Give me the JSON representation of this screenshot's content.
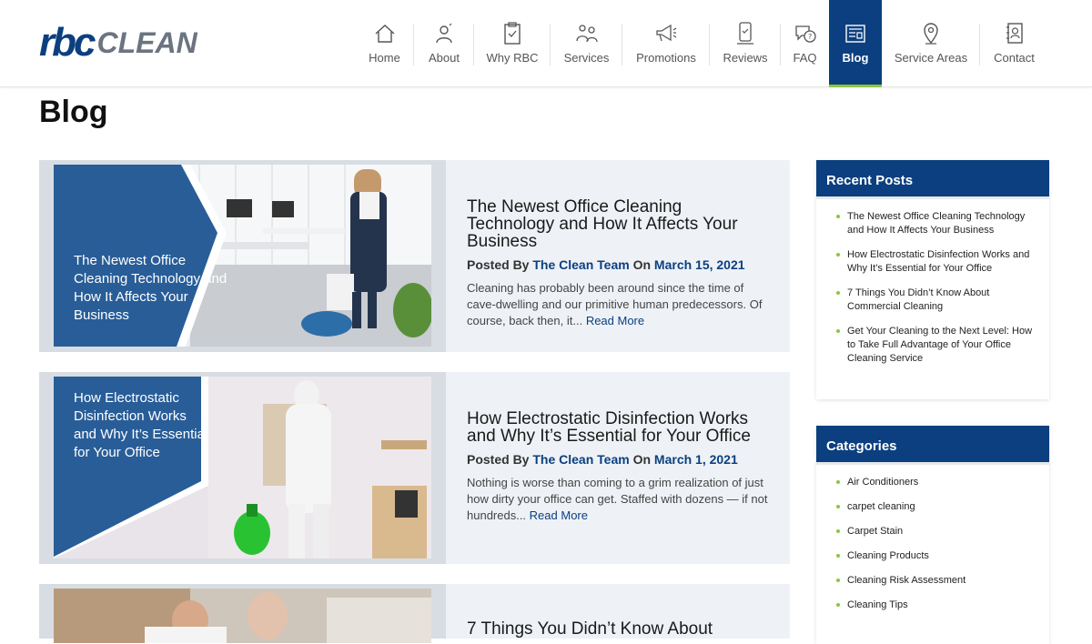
{
  "brand": {
    "logo_part1": "rbc",
    "logo_part2": "CLEAN",
    "primary_color": "#0b3f7f",
    "accent_color": "#8cc63f"
  },
  "nav": [
    {
      "label": "Home",
      "icon": "home-icon"
    },
    {
      "label": "About",
      "icon": "person-icon"
    },
    {
      "label": "Why RBC",
      "icon": "clipboard-icon"
    },
    {
      "label": "Services",
      "icon": "cleaning-people-icon"
    },
    {
      "label": "Promotions",
      "icon": "megaphone-icon"
    },
    {
      "label": "Reviews",
      "icon": "phone-review-icon"
    },
    {
      "label": "FAQ",
      "icon": "chat-question-icon"
    },
    {
      "label": "Blog",
      "icon": "blog-icon",
      "active": true
    },
    {
      "label": "Service Areas",
      "icon": "location-pin-icon"
    },
    {
      "label": "Contact",
      "icon": "address-book-icon"
    }
  ],
  "page_title": "Blog",
  "posts": [
    {
      "image_overlay": "The Newest Office Cleaning Technology and How It Affects Your Business",
      "title": "The Newest Office Cleaning Technology and How It Affects Your Business",
      "posted_by_label": "Posted By",
      "author": "The Clean Team",
      "on_label": "On",
      "date": "March 15, 2021",
      "excerpt": "Cleaning has probably been around since the time of cave-dwelling and our primitive human predecessors. Of course, back then, it...",
      "read_more": "Read More"
    },
    {
      "image_overlay": "How Electrostatic Disinfection Works and Why It’s Essential for Your Office",
      "title": "How Electrostatic Disinfection Works and Why It’s Essential for Your Office",
      "posted_by_label": "Posted By",
      "author": "The Clean Team",
      "on_label": "On",
      "date": "March 1, 2021",
      "excerpt": "Nothing is worse than coming to a grim realization of just how dirty your office can get. Staffed with dozens — if not hundreds...",
      "read_more": "Read More"
    },
    {
      "title": "7 Things You Didn’t Know About"
    }
  ],
  "sidebar": {
    "recent_posts_title": "Recent Posts",
    "recent_posts": [
      "The Newest Office Cleaning Technology and How It Affects Your Business",
      "How Electrostatic Disinfection Works and Why It’s Essential for Your Office",
      "7 Things You Didn’t Know About Commercial Cleaning",
      "Get Your Cleaning to the Next Level: How to Take Full Advantage of Your Office Cleaning Service"
    ],
    "categories_title": "Categories",
    "categories": [
      "Air Conditioners",
      "carpet cleaning",
      "Carpet Stain",
      "Cleaning Products",
      "Cleaning Risk Assessment",
      "Cleaning Tips"
    ]
  }
}
